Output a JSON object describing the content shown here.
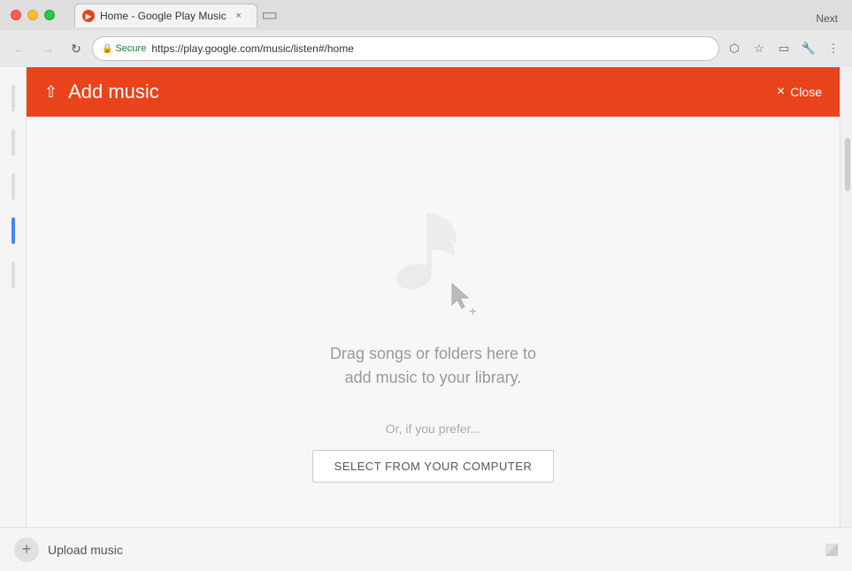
{
  "browser": {
    "title": "Home - Google Play Music",
    "tab_close_label": "×",
    "new_tab_label": "+",
    "next_label": "Next",
    "nav": {
      "back_label": "←",
      "forward_label": "→",
      "refresh_label": "↻",
      "secure_label": "Secure",
      "address": "https://play.google.com/music/listen#/home"
    },
    "toolbar_icons": {
      "cast": "⬡",
      "bookmark": "☆",
      "screencast": "▭",
      "menu": "⋮"
    }
  },
  "panel": {
    "title": "Add music",
    "close_label": "Close",
    "close_icon": "×",
    "upload_icon": "↑",
    "drag_text_line1": "Drag songs or folders here to",
    "drag_text_line2": "add music to your library.",
    "or_text": "Or, if you prefer...",
    "select_btn_label": "SELECT FROM YOUR COMPUTER"
  },
  "bottom_bar": {
    "upload_circle_icon": "+",
    "upload_label": "Upload music"
  },
  "colors": {
    "header_bg": "#e8431a",
    "header_text": "#ffffff",
    "drag_text": "#999999",
    "button_border": "#cccccc"
  }
}
